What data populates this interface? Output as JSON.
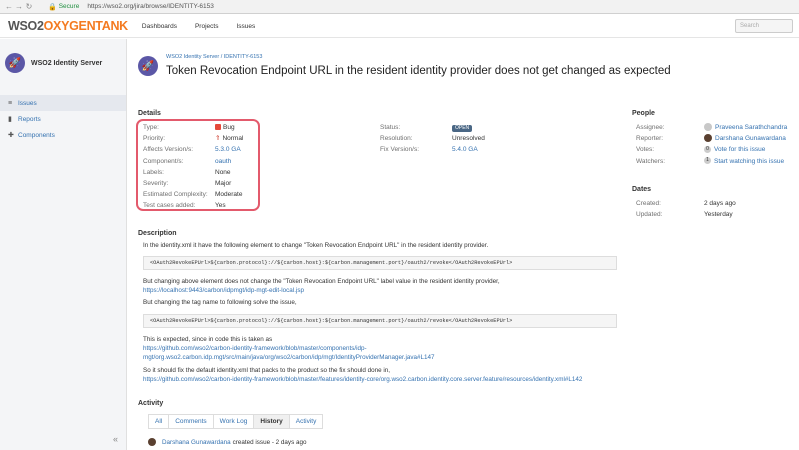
{
  "browser": {
    "secure_label": "Secure",
    "url": "https://wso2.org/jira/browse/IDENTITY-6153"
  },
  "header": {
    "logo_wso2": "WSO2",
    "logo_oxygen": "OXYGENTANK",
    "nav": [
      "Dashboards",
      "Projects",
      "Issues"
    ],
    "search_placeholder": "Search"
  },
  "sidebar": {
    "project_name": "WSO2 Identity Server",
    "items": [
      {
        "label": "Issues",
        "icon": "list-icon"
      },
      {
        "label": "Reports",
        "icon": "chart-icon"
      },
      {
        "label": "Components",
        "icon": "puzzle-icon"
      }
    ],
    "collapse": "«"
  },
  "issue": {
    "breadcrumb": "WSO2 Identity Server / IDENTITY-6153",
    "title": "Token Revocation Endpoint URL in the resident identity provider does not get changed as expected"
  },
  "details": {
    "heading": "Details",
    "left": [
      {
        "label": "Type:",
        "value": "Bug"
      },
      {
        "label": "Priority:",
        "value": "Normal"
      },
      {
        "label": "Affects Version/s:",
        "value": "5.3.0 GA"
      },
      {
        "label": "Component/s:",
        "value": "oauth"
      },
      {
        "label": "Labels:",
        "value": "None"
      },
      {
        "label": "Severity:",
        "value": "Major"
      },
      {
        "label": "Estimated Complexity:",
        "value": "Moderate"
      },
      {
        "label": "Test cases added:",
        "value": "Yes"
      }
    ],
    "right": [
      {
        "label": "Status:",
        "value": "OPEN"
      },
      {
        "label": "Resolution:",
        "value": "Unresolved"
      },
      {
        "label": "Fix Version/s:",
        "value": "5.4.0 GA"
      }
    ]
  },
  "people": {
    "heading": "People",
    "rows": [
      {
        "label": "Assignee:",
        "value": "Praveena Sarathchandra"
      },
      {
        "label": "Reporter:",
        "value": "Darshana Gunawardana"
      },
      {
        "label": "Votes:",
        "count": "0",
        "value": "Vote for this issue"
      },
      {
        "label": "Watchers:",
        "count": "1",
        "value": "Start watching this issue"
      }
    ]
  },
  "dates": {
    "heading": "Dates",
    "rows": [
      {
        "label": "Created:",
        "value": "2 days ago"
      },
      {
        "label": "Updated:",
        "value": "Yesterday"
      }
    ]
  },
  "description": {
    "heading": "Description",
    "p1": "In the identity.xml it have the following element to change \"Token Revocation Endpoint URL\" in the resident identity provider.",
    "code1": "<OAuth2RevokeEPUrl>${carbon.protocol}://${carbon.host}:${carbon.management.port}/oauth2/revoke</OAuth2RevokeEPUrl>",
    "p2": "But changing above element does not change the \"Token Revocation Endpoint URL\" label value in the resident identity provider,",
    "link1": "https://localhost:9443/carbon/idpmgt/idp-mgt-edit-local.jsp",
    "p3": "But changing the tag name to following solve the issue,",
    "code2": "<OAuth2RevokeEPUrl>${carbon.protocol}://${carbon.host}:${carbon.management.port}/oauth2/revoke</OAuth2RevokeEPUrl>",
    "p4": "This is expected, since in code this is taken as",
    "link2": "https://github.com/wso2/carbon-identity-framework/blob/master/components/idp-",
    "link2b": "mgt/org.wso2.carbon.idp.mgt/src/main/java/org/wso2/carbon/idp/mgt/IdentityProviderManager.java#L147",
    "p5": "So it should fix the default identity.xml that packs to the product so the fix should done in,",
    "link3": "https://github.com/wso2/carbon-identity-framework/blob/master/features/identity-core/org.wso2.carbon.identity.core.server.feature/resources/identity.xml#L142"
  },
  "activity": {
    "heading": "Activity",
    "tabs": [
      "All",
      "Comments",
      "Work Log",
      "History",
      "Activity"
    ],
    "active_tab": "History",
    "entry_user": "Darshana Gunawardana",
    "entry_text": "created issue - 2 days ago"
  }
}
